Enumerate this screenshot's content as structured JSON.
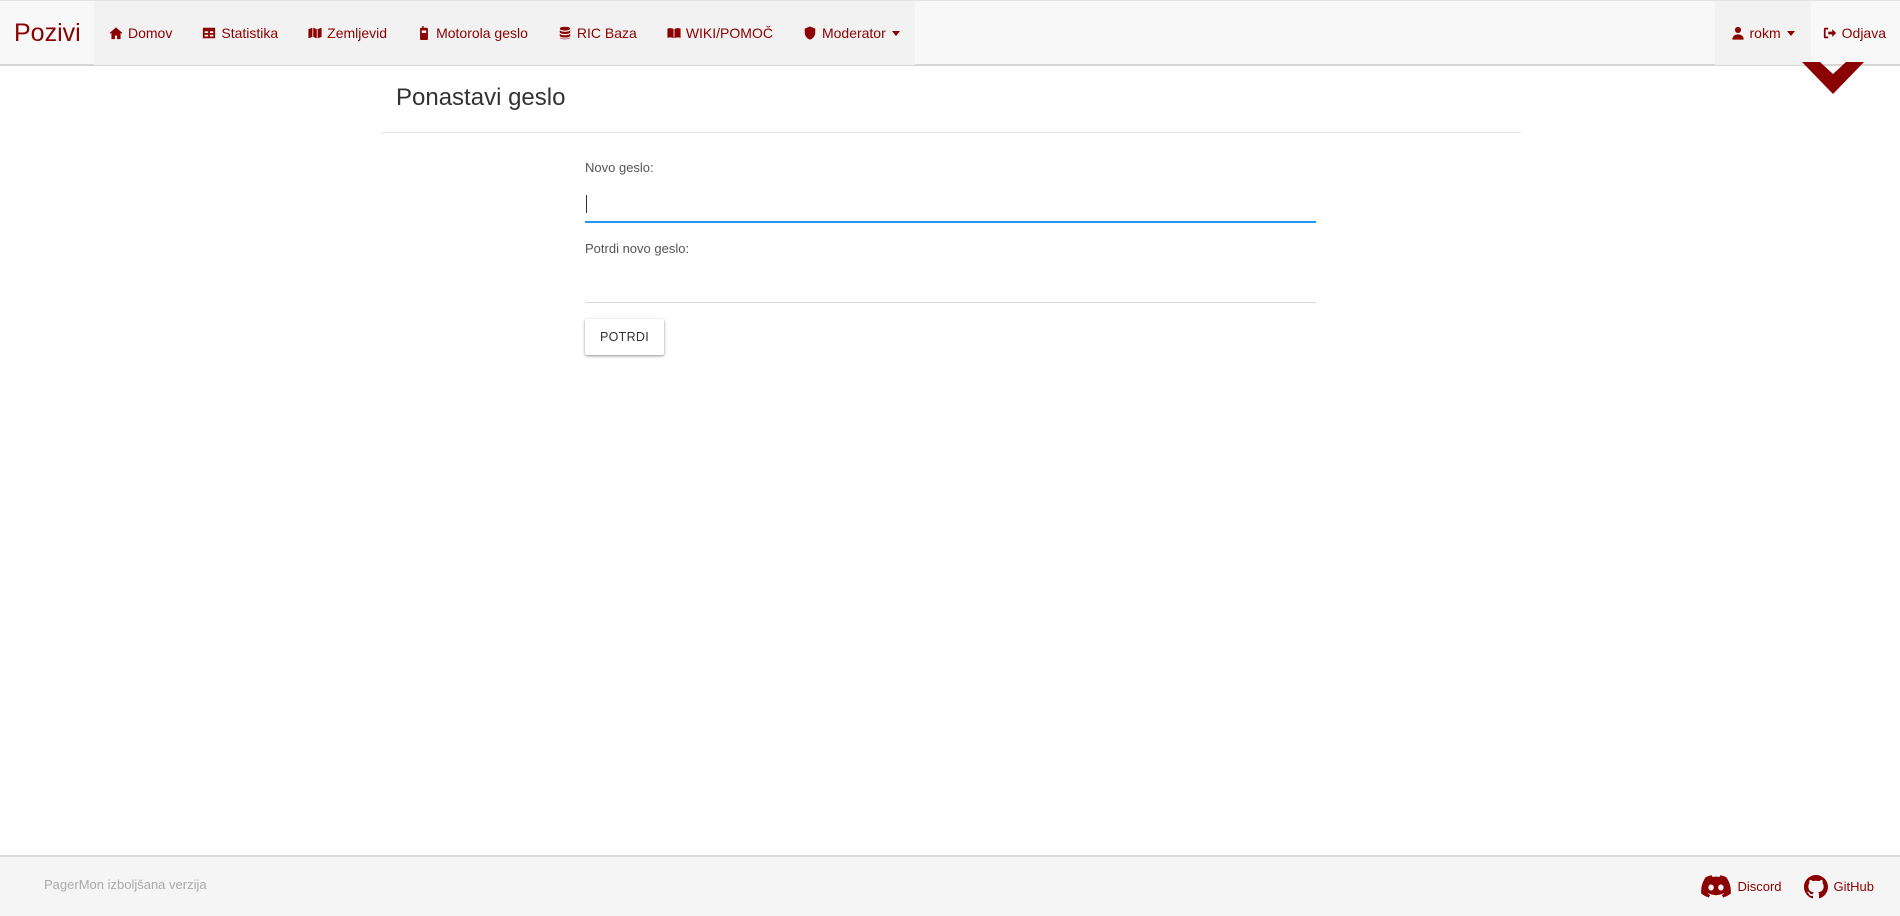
{
  "navbar": {
    "brand": "Pozivi",
    "items": [
      {
        "label": "Domov",
        "icon": "home-icon"
      },
      {
        "label": "Statistika",
        "icon": "table-icon"
      },
      {
        "label": "Zemljevid",
        "icon": "map-icon"
      },
      {
        "label": "Motorola geslo",
        "icon": "pager-icon"
      },
      {
        "label": "RIC Baza",
        "icon": "database-icon"
      },
      {
        "label": "WIKI/POMOČ",
        "icon": "book-icon"
      },
      {
        "label": "Moderator",
        "icon": "shield-icon",
        "dropdown": true
      }
    ],
    "user": {
      "label": "rokm",
      "icon": "user-icon",
      "dropdown": true
    },
    "logout": {
      "label": "Odjava",
      "icon": "sign-out-icon"
    }
  },
  "main": {
    "title": "Ponastavi geslo",
    "form": {
      "new_password_label": "Novo geslo:",
      "new_password_value": "",
      "confirm_password_label": "Potrdi novo geslo:",
      "confirm_password_value": "",
      "submit_label": "POTRDI"
    }
  },
  "footer": {
    "text": "PagerMon izboljšana verzija",
    "links": [
      {
        "label": "Discord",
        "icon": "discord-icon"
      },
      {
        "label": "GitHub",
        "icon": "github-icon"
      }
    ]
  },
  "colors": {
    "accent": "#8b0000",
    "input_focus": "#2196f3",
    "navbar_bg": "#f8f8f8",
    "footer_text": "#aaaaaa"
  }
}
